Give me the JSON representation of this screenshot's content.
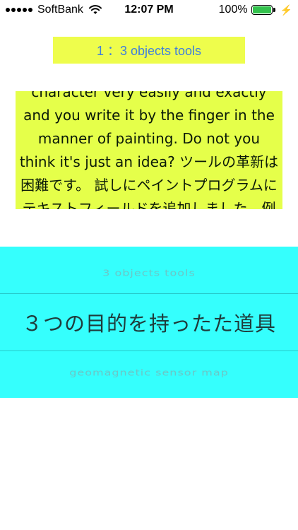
{
  "status_bar": {
    "carrier": "SoftBank",
    "time": "12:07 PM",
    "battery_percent": "100%",
    "battery_level": 1.0,
    "battery_color": "#33c24d",
    "icons": [
      "signal-icon",
      "wifi-icon",
      "battery-icon",
      "charging-icon"
    ]
  },
  "title_banner": {
    "text": "1 ：3 objects tools"
  },
  "text_panel": {
    "text": "character very easily and  exactly and you write it  by the finger in the manner of painting. Do not you think it's just an idea?  ツールの革新は困難です。 試しにペイントプログラムにテキストフィールドを追加しました。例えば、"
  },
  "picker": {
    "items": [
      "3 objects tools",
      "３つの目的を持ったた道具",
      "geomagnetic sensor map"
    ],
    "selected_index": 1
  },
  "colors": {
    "banner_bg": "#eefd4c",
    "banner_text": "#3f7fdc",
    "text_panel_bg": "#e5ff4a",
    "picker_bg": "#35fffd"
  }
}
